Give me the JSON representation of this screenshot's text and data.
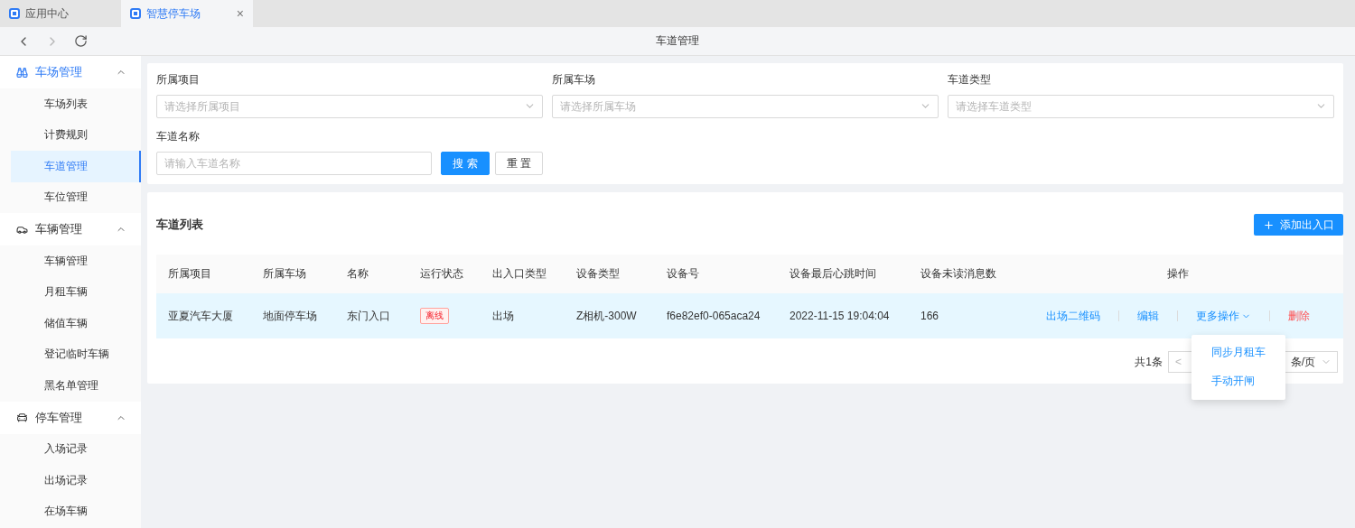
{
  "tabs": [
    {
      "label": "应用中心",
      "selected": false
    },
    {
      "label": "智慧停车场",
      "selected": true,
      "close": "×"
    }
  ],
  "nav": {
    "title": "车道管理",
    "back_disabled": false,
    "forward_disabled": true
  },
  "sidebar": {
    "groups": [
      {
        "label": "车场管理",
        "active": true,
        "expanded": true,
        "items": [
          {
            "label": "车场列表",
            "selected": false
          },
          {
            "label": "计费规则",
            "selected": false
          },
          {
            "label": "车道管理",
            "selected": true
          },
          {
            "label": "车位管理",
            "selected": false
          }
        ]
      },
      {
        "label": "车辆管理",
        "active": false,
        "expanded": true,
        "items": [
          {
            "label": "车辆管理",
            "selected": false
          },
          {
            "label": "月租车辆",
            "selected": false
          },
          {
            "label": "储值车辆",
            "selected": false
          },
          {
            "label": "登记临时车辆",
            "selected": false
          },
          {
            "label": "黑名单管理",
            "selected": false
          }
        ]
      },
      {
        "label": "停车管理",
        "active": false,
        "expanded": true,
        "items": [
          {
            "label": "入场记录",
            "selected": false
          },
          {
            "label": "出场记录",
            "selected": false
          },
          {
            "label": "在场车辆",
            "selected": false
          }
        ]
      }
    ]
  },
  "filters": [
    {
      "label": "所属项目",
      "kind": "select",
      "placeholder": "请选择所属项目"
    },
    {
      "label": "所属车场",
      "kind": "select",
      "placeholder": "请选择所属车场"
    },
    {
      "label": "车道类型",
      "kind": "select",
      "placeholder": "请选择车道类型"
    },
    {
      "label": "车道名称",
      "kind": "input",
      "placeholder": "请输入车道名称"
    }
  ],
  "filter_buttons": [
    {
      "label": "搜 索",
      "kind": "primary"
    },
    {
      "label": "重 置",
      "kind": "default"
    }
  ],
  "list": {
    "title": "车道列表",
    "add_button": "添加出入口",
    "columns": [
      "所属项目",
      "所属车场",
      "名称",
      "运行状态",
      "出入口类型",
      "设备类型",
      "设备号",
      "设备最后心跳时间",
      "设备未读消息数",
      "操作"
    ],
    "rows": [
      {
        "selected": true,
        "cells": [
          {
            "kind": "text",
            "label": "亚夏汽车大厦"
          },
          {
            "kind": "text",
            "label": "地面停车场"
          },
          {
            "kind": "text",
            "label": "东门入口"
          },
          {
            "kind": "tag",
            "label": "离线"
          },
          {
            "kind": "text",
            "label": "出场"
          },
          {
            "kind": "text",
            "label": "Z相机-300W"
          },
          {
            "kind": "text",
            "label": "f6e82ef0-065aca24"
          },
          {
            "kind": "text",
            "label": "2022-11-15 19:04:04"
          },
          {
            "kind": "text",
            "label": "166"
          }
        ],
        "actions": [
          {
            "label": "出场二维码",
            "kind": "link"
          },
          {
            "label": "编辑",
            "kind": "link"
          },
          {
            "label": "更多操作",
            "kind": "dropdown",
            "expanded": true,
            "menu": [
              "同步月租车",
              "手动开闸"
            ]
          },
          {
            "label": "删除",
            "kind": "danger"
          }
        ]
      }
    ]
  },
  "pagination": {
    "total": "共1条",
    "prev": "<",
    "page_size": "条/页"
  }
}
